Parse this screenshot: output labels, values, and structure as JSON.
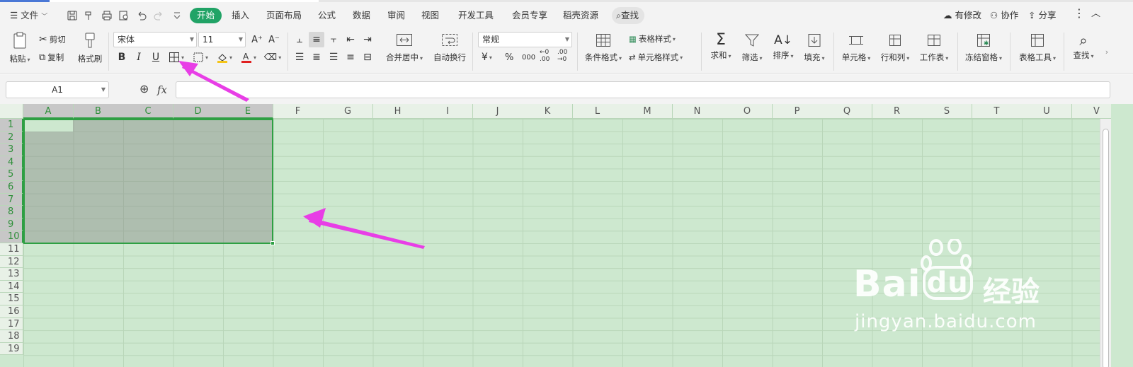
{
  "menubar": {
    "file_menu": "文件",
    "tabs": [
      "开始",
      "插入",
      "页面布局",
      "公式",
      "数据",
      "审阅",
      "视图",
      "开发工具",
      "会员专享",
      "稻壳资源"
    ],
    "search_label": "查找",
    "right": {
      "modified": "有修改",
      "collab": "协作",
      "share": "分享"
    }
  },
  "ribbon": {
    "clipboard": {
      "paste": "粘贴",
      "cut": "剪切",
      "copy": "复制",
      "format_painter": "格式刷"
    },
    "font": {
      "name": "宋体",
      "size": "11",
      "bold": "B",
      "italic": "I",
      "underline": "U"
    },
    "align": {
      "merge": "合并居中",
      "wrap": "自动换行"
    },
    "number": {
      "format": "常规",
      "currency": "¥",
      "percent": "%",
      "thousands": "000"
    },
    "styles": {
      "conditional": "条件格式",
      "table_style": "表格样式",
      "cell_style": "单元格样式"
    },
    "editing": {
      "sum": "求和",
      "filter": "筛选",
      "sort": "排序",
      "fill": "填充"
    },
    "cells": {
      "cell": "单元格",
      "row_col": "行和列",
      "worksheet": "工作表"
    },
    "window": {
      "freeze": "冻结窗格"
    },
    "tools": {
      "table_tools": "表格工具"
    },
    "find": {
      "find": "查找"
    }
  },
  "formula_bar": {
    "name_box": "A1",
    "fx": "fx",
    "value": ""
  },
  "sheet": {
    "columns": [
      "A",
      "B",
      "C",
      "D",
      "E",
      "F",
      "G",
      "H",
      "I",
      "J",
      "K",
      "L",
      "M",
      "N",
      "O",
      "P",
      "Q",
      "R",
      "S",
      "T",
      "U",
      "V"
    ],
    "rows": [
      "1",
      "2",
      "3",
      "4",
      "5",
      "6",
      "7",
      "8",
      "9",
      "10",
      "11",
      "12",
      "13",
      "14",
      "15",
      "16",
      "17",
      "18",
      "19"
    ],
    "selected_columns": [
      "A",
      "B",
      "C",
      "D",
      "E"
    ],
    "selected_rows": [
      "1",
      "2",
      "3",
      "4",
      "5",
      "6",
      "7",
      "8",
      "9",
      "10"
    ],
    "background_color": "#cde8cf",
    "selection_border_color": "#2ea043"
  },
  "annotations": {
    "arrow_color": "#e83ee6"
  },
  "watermark": {
    "brand": "Bai",
    "brand_du": "du",
    "jingyan": "经验",
    "url": "jingyan.baidu.com"
  }
}
